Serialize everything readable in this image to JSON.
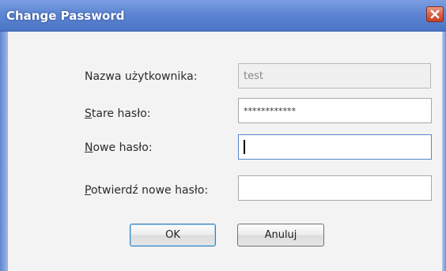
{
  "window": {
    "title": "Change Password"
  },
  "form": {
    "username_label_mnemonic": "",
    "username_label_rest": "Nazwa użytkownika:",
    "username_value": "test",
    "old_password_label_mnemonic": "S",
    "old_password_label_rest": "tare hasło:",
    "old_password_value": "************",
    "new_password_label_mnemonic": "N",
    "new_password_label_rest": "owe hasło:",
    "new_password_value": "",
    "confirm_password_label_mnemonic": "P",
    "confirm_password_label_rest": "otwierdź nowe hasło:",
    "confirm_password_value": ""
  },
  "buttons": {
    "ok_label": "OK",
    "cancel_label": "Anuluj"
  },
  "icons": {
    "close": "close-icon"
  },
  "colors": {
    "titlebar": "#5e86d3",
    "close_button": "#d45f45",
    "default_button_border": "#3c7fb1"
  }
}
